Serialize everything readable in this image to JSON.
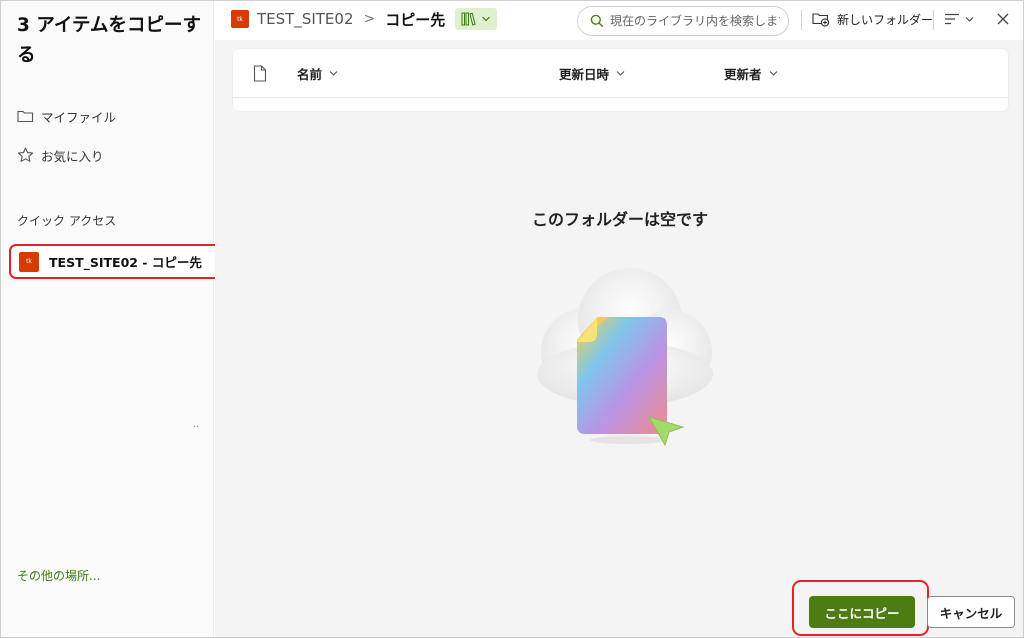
{
  "dialog": {
    "title": "3 アイテムをコピーする"
  },
  "sidebar": {
    "items": [
      {
        "label": "マイファイル",
        "icon": "folder-icon"
      },
      {
        "label": "お気に入り",
        "icon": "star-icon"
      }
    ],
    "quick_access_heading": "クイック アクセス",
    "quick_access": [
      {
        "label": "TEST_SITE02 - コピー先",
        "badge": "tk"
      }
    ],
    "more_dots": "..",
    "other_places": "その他の場所..."
  },
  "breadcrumb": {
    "badge": "tk",
    "site": "TEST_SITE02",
    "separator": ">",
    "current": "コピー先"
  },
  "search": {
    "placeholder": "現在のライブラリ内を検索します"
  },
  "toolbar": {
    "new_folder": "新しいフォルダー"
  },
  "table": {
    "columns": [
      "名前",
      "更新日時",
      "更新者"
    ]
  },
  "empty": {
    "title": "このフォルダーは空です"
  },
  "footer": {
    "copy_label": "ここにコピー",
    "cancel_label": "キャンセル"
  },
  "colors": {
    "accent": "#4d7d12",
    "highlight": "#e8202a",
    "site_badge": "#d83b01"
  }
}
